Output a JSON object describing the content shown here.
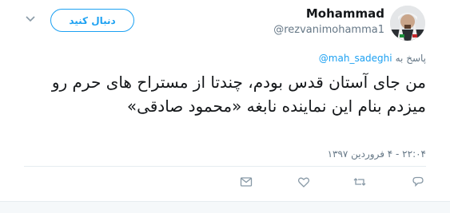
{
  "author": {
    "name": "Mohammad",
    "handle": "@rezvanimohamma1"
  },
  "follow_button": {
    "label": "دنبال کنید"
  },
  "reply_to": {
    "prefix": "پاسخ به",
    "handle": "@mah_sadeghi"
  },
  "tweet": {
    "text": "من جای آستان قدس بودم، چندتا از مستراح های حرم رو میزدم بنام این نماینده نابغه «محمود صادقی»",
    "timestamp": "۲۲:۰۴ - ۴ فروردین ۱۳۹۷"
  },
  "actions": [
    "reply-icon",
    "retweet-icon",
    "like-icon",
    "message-icon"
  ],
  "colors": {
    "accent": "#1da1f2",
    "text": "#14171a",
    "muted": "#657786",
    "divider": "#e6ecf0"
  }
}
